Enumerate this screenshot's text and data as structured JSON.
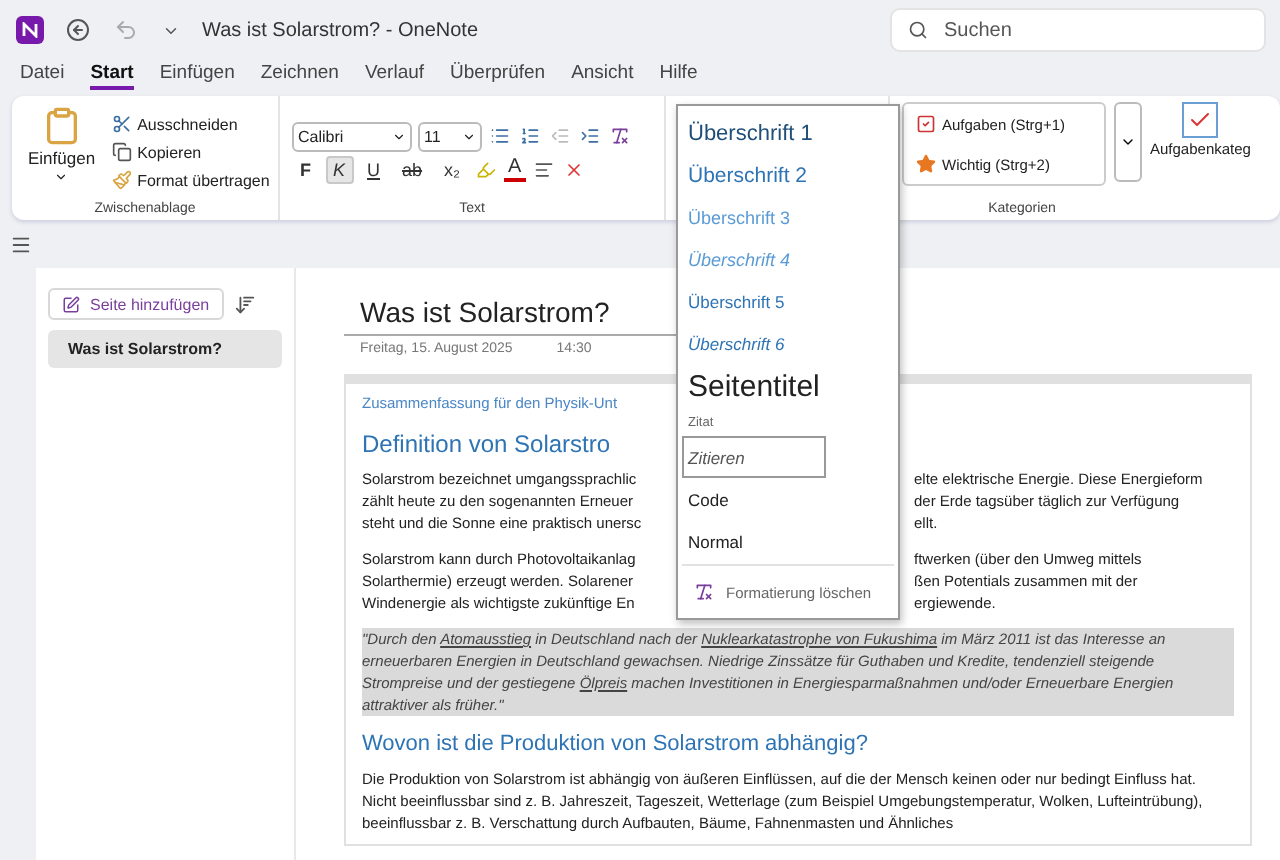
{
  "window": {
    "title": "Was ist Solarstrom?  -  OneNote"
  },
  "search": {
    "placeholder": "Suchen"
  },
  "tabs": [
    {
      "label": "Datei",
      "selected": false
    },
    {
      "label": "Start",
      "selected": true
    },
    {
      "label": "Einfügen",
      "selected": false
    },
    {
      "label": "Zeichnen",
      "selected": false
    },
    {
      "label": "Verlauf",
      "selected": false
    },
    {
      "label": "Überprüfen",
      "selected": false
    },
    {
      "label": "Ansicht",
      "selected": false
    },
    {
      "label": "Hilfe",
      "selected": false
    }
  ],
  "clipboard": {
    "paste": "Einfügen",
    "cut": "Ausschneiden",
    "copy": "Kopieren",
    "format_painter": "Format übertragen",
    "group": "Zwischenablage"
  },
  "text_group": {
    "font": "Calibri",
    "size": "11",
    "group": "Text",
    "font_color": "A",
    "format_buttons": [
      {
        "label": "F",
        "kind": "bold",
        "selected": false
      },
      {
        "label": "K",
        "kind": "italic",
        "selected": true
      },
      {
        "label": "U",
        "kind": "underline",
        "selected": false
      },
      {
        "label": "ab",
        "kind": "strike",
        "selected": false
      },
      {
        "label": "x₂",
        "kind": "subscript",
        "selected": false
      }
    ]
  },
  "categories": {
    "items": [
      {
        "label": "Aufgaben (Strg+1)",
        "kind": "task"
      },
      {
        "label": "Wichtig (Strg+2)",
        "kind": "star"
      }
    ],
    "task_button": "Aufgabenkateg",
    "group": "Kategorien"
  },
  "styles_menu": {
    "items": [
      {
        "label": "Überschrift 1",
        "kind": "h1",
        "selected": false
      },
      {
        "label": "Überschrift 2",
        "kind": "h2",
        "selected": false
      },
      {
        "label": "Überschrift 3",
        "kind": "h3",
        "selected": false
      },
      {
        "label": "Überschrift 4",
        "kind": "h4",
        "selected": false
      },
      {
        "label": "Überschrift 5",
        "kind": "h5",
        "selected": false
      },
      {
        "label": "Überschrift 6",
        "kind": "h6",
        "selected": false
      },
      {
        "label": "Seitentitel",
        "kind": "page_title",
        "selected": false
      },
      {
        "label": "Zitat",
        "kind": "citation",
        "selected": false
      },
      {
        "label": "Zitieren",
        "kind": "quote",
        "selected": true
      },
      {
        "label": "Code",
        "kind": "code",
        "selected": false
      },
      {
        "label": "Normal",
        "kind": "normal",
        "selected": false
      }
    ],
    "clear": "Formatierung löschen"
  },
  "sidebar": {
    "add_page": "Seite hinzufügen",
    "pages": [
      {
        "title": "Was ist Solarstrom?",
        "selected": true
      }
    ]
  },
  "page": {
    "title": "Was ist Solarstrom?",
    "date": "Freitag, 15. August 2025",
    "time": "14:30",
    "subtitle": "Zusammenfassung für den Physik-Unt",
    "heading1": "Definition von Solarstro",
    "covered_paragraphs": [
      [
        {
          "left": "Solarstrom bezeichnet umgangssprachlic",
          "right": "elte elektrische Energie. Diese Energieform"
        },
        {
          "left": "zählt heute zu den sogenannten Erneuer",
          "right": "der Erde tagsüber täglich zur Verfügung"
        },
        {
          "left": "steht und die Sonne eine praktisch unersc",
          "right": "ellt."
        }
      ],
      [
        {
          "left": "Solarstrom kann durch Photovoltaikanlag",
          "right": "ftwerken (über den Umweg mittels"
        },
        {
          "left": "Solarthermie) erzeugt werden. Solarener",
          "right": "ßen Potentials zusammen mit der"
        },
        {
          "left": "Windenergie als wichtigste zukünftige En",
          "right": "ergiewende."
        }
      ]
    ],
    "quote": [
      {
        "text": "\"Durch den ",
        "link": false
      },
      {
        "text": "Atomausstieg",
        "link": true
      },
      {
        "text": " in Deutschland nach der ",
        "link": false
      },
      {
        "text": "Nuklearkatastrophe von Fukushima",
        "link": true
      },
      {
        "text": " im März 2011 ist das Interesse an erneuerbaren Energien in Deutschland gewachsen. Niedrige Zinssätze für Guthaben und Kredite, tendenziell steigende Strompreise und der gestiegene ",
        "link": false
      },
      {
        "text": "Ölpreis",
        "link": true
      },
      {
        "text": " machen Investitionen in Energiesparmaßnahmen und/oder Erneuerbare Energien attraktiver als früher.\"",
        "link": false
      }
    ],
    "heading2": "Wovon ist die Produktion von Solarstrom abhängig?",
    "paragraph": "Die Produktion von Solarstrom ist abhängig von äußeren Einflüssen, auf die der Mensch keinen oder nur bedingt Einfluss hat. Nicht beeinflussbar sind z. B. Jahreszeit, Tageszeit, Wetterlage (zum Beispiel Umgebungstemperatur, Wolken, Lufteintrübung), beeinflussbar z. B. Verschattung durch Aufbauten, Bäume, Fahnenmasten und Ähnliches"
  }
}
